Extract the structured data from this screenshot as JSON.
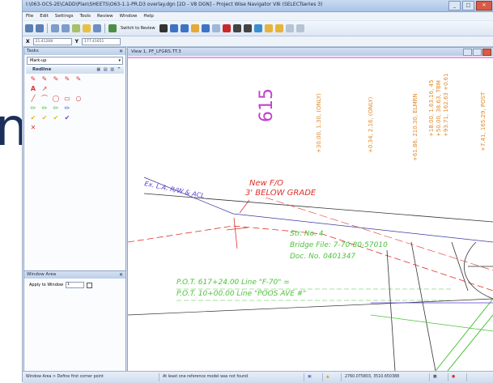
{
  "window": {
    "title": "I:\\063-OCS-2E\\CADD\\Plan\\SHEETS\\O63-1.1-PR.D3 overlay.dgn [2D - V8 DGN] - Project Wise Navigator V8i (SELECTseries 3)"
  },
  "menu": [
    "File",
    "Edit",
    "Settings",
    "Tools",
    "Review",
    "Window",
    "Help"
  ],
  "toolbar": {
    "switch_label": "Switch to Review"
  },
  "coords": {
    "x_label": "X",
    "x_value": "21.41268",
    "y_label": "Y",
    "y_value": "177.41651"
  },
  "tasks": {
    "title": "Tasks",
    "selected": "Mark-up",
    "section": "Redline",
    "section_controls": "▦ ▤ ▥ ^"
  },
  "window_area": {
    "title": "Window Area",
    "apply_label": "Apply to Window",
    "apply_value": "1"
  },
  "view": {
    "title": "View 1, PF_LFGRS.TT.3"
  },
  "drawing": {
    "station_num": "615",
    "vert1": "+30.00, 1.30, (ONLY)",
    "vert2": "+0.34, 2.16, (ONLY)",
    "vert3": "+61.86, 210.30, ELMRN",
    "vert4": "+18.00, 1.63.16, 45",
    "vert5": "+50.00, 38.63, TBM",
    "vert6": "+93.71, 162.63 +0.61",
    "vert7": "+7.41, 165.29, POST",
    "redline1": "New F/O",
    "redline2": "3' BELOW GRADE",
    "row_label": "Ex. L.A. R/W & ACL",
    "str_no": "Str. No. 4",
    "bridge_file": "Bridge File: 7-70-80-57010",
    "doc_no": "Doc. No. 0401347",
    "pot1": "P.O.T. 617+24.00 Line \"F-70\" =",
    "pot2": "P.O.T. 10+00.00 Line \"POOS AVE #\""
  },
  "status": {
    "left": "Window Area > Define first corner point",
    "middle": "At least one reference model was not found",
    "coords": "2760.075803, 3510.650388"
  },
  "colors": {
    "redline": "#e0302a",
    "markup_green": "#4cc23a",
    "station_magenta": "#c43fd0",
    "annotation_orange": "#e08a2a"
  }
}
